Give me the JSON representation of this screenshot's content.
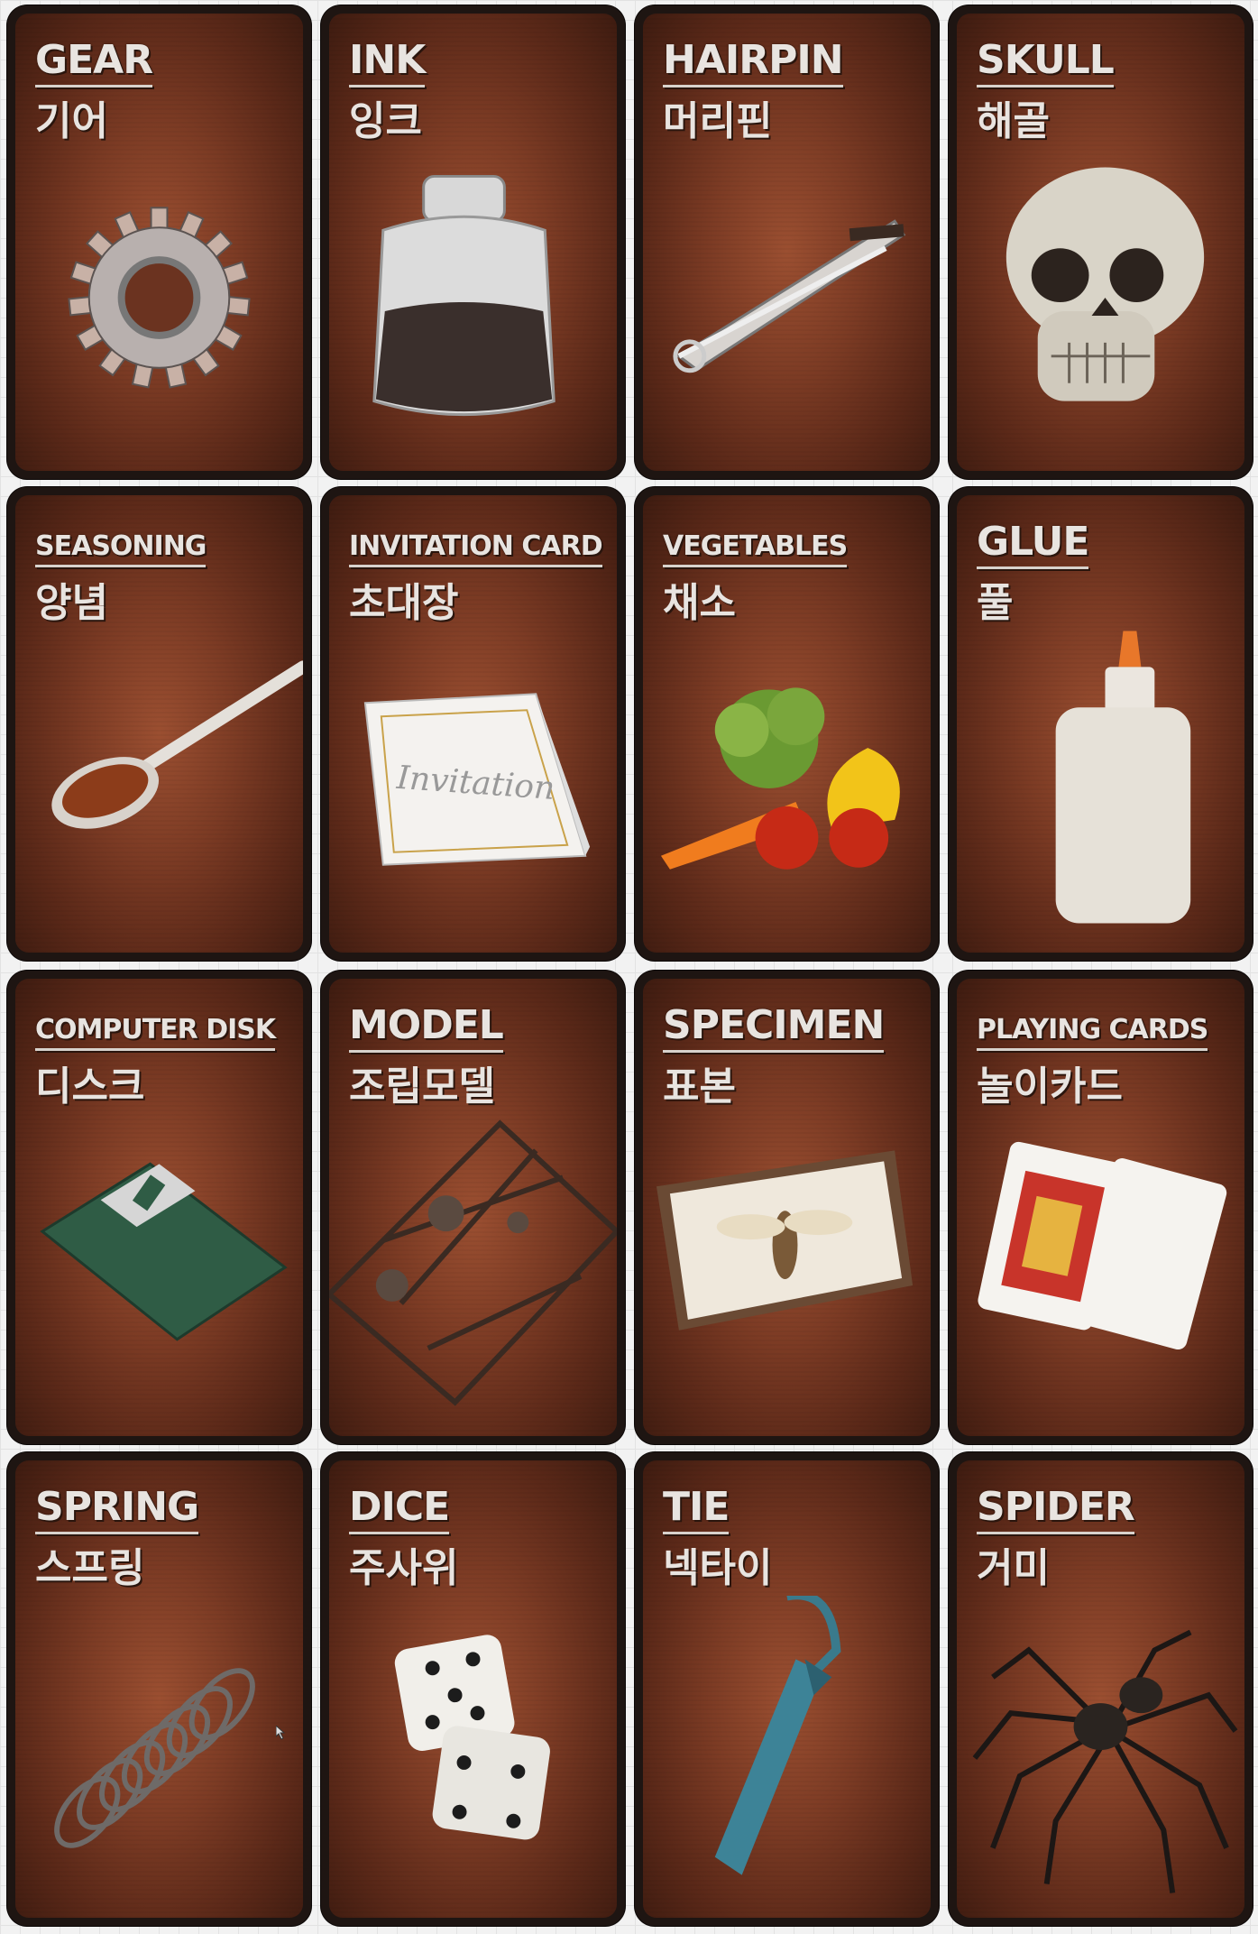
{
  "cards": [
    {
      "en": "GEAR",
      "ko": "기어",
      "icon": "gear-icon"
    },
    {
      "en": "INK",
      "ko": "잉크",
      "icon": "ink-bottle-icon"
    },
    {
      "en": "HAIRPIN",
      "ko": "머리핀",
      "icon": "hairpin-icon"
    },
    {
      "en": "SKULL",
      "ko": "해골",
      "icon": "skull-icon"
    },
    {
      "en": "SEASONING",
      "ko": "양념",
      "icon": "spoon-seasoning-icon"
    },
    {
      "en": "INVITATION CARD",
      "ko": "초대장",
      "icon": "invitation-card-icon",
      "card_text": "Invitation"
    },
    {
      "en": "VEGETABLES",
      "ko": "채소",
      "icon": "vegetables-icon"
    },
    {
      "en": "GLUE",
      "ko": "풀",
      "icon": "glue-bottle-icon"
    },
    {
      "en": "COMPUTER DISK",
      "ko": "디스크",
      "icon": "floppy-disk-icon"
    },
    {
      "en": "MODEL",
      "ko": "조립모델",
      "icon": "model-kit-icon"
    },
    {
      "en": "SPECIMEN",
      "ko": "표본",
      "icon": "insect-specimen-icon"
    },
    {
      "en": "PLAYING CARDS",
      "ko": "놀이카드",
      "icon": "playing-cards-icon"
    },
    {
      "en": "SPRING",
      "ko": "스프링",
      "icon": "spring-icon"
    },
    {
      "en": "DICE",
      "ko": "주사위",
      "icon": "dice-icon"
    },
    {
      "en": "TIE",
      "ko": "넥타이",
      "icon": "necktie-icon"
    },
    {
      "en": "SPIDER",
      "ko": "거미",
      "icon": "spider-icon"
    }
  ],
  "colors": {
    "card_bg": "#7c3b24",
    "card_border": "#1e1512",
    "title": "#e8e4e0"
  }
}
